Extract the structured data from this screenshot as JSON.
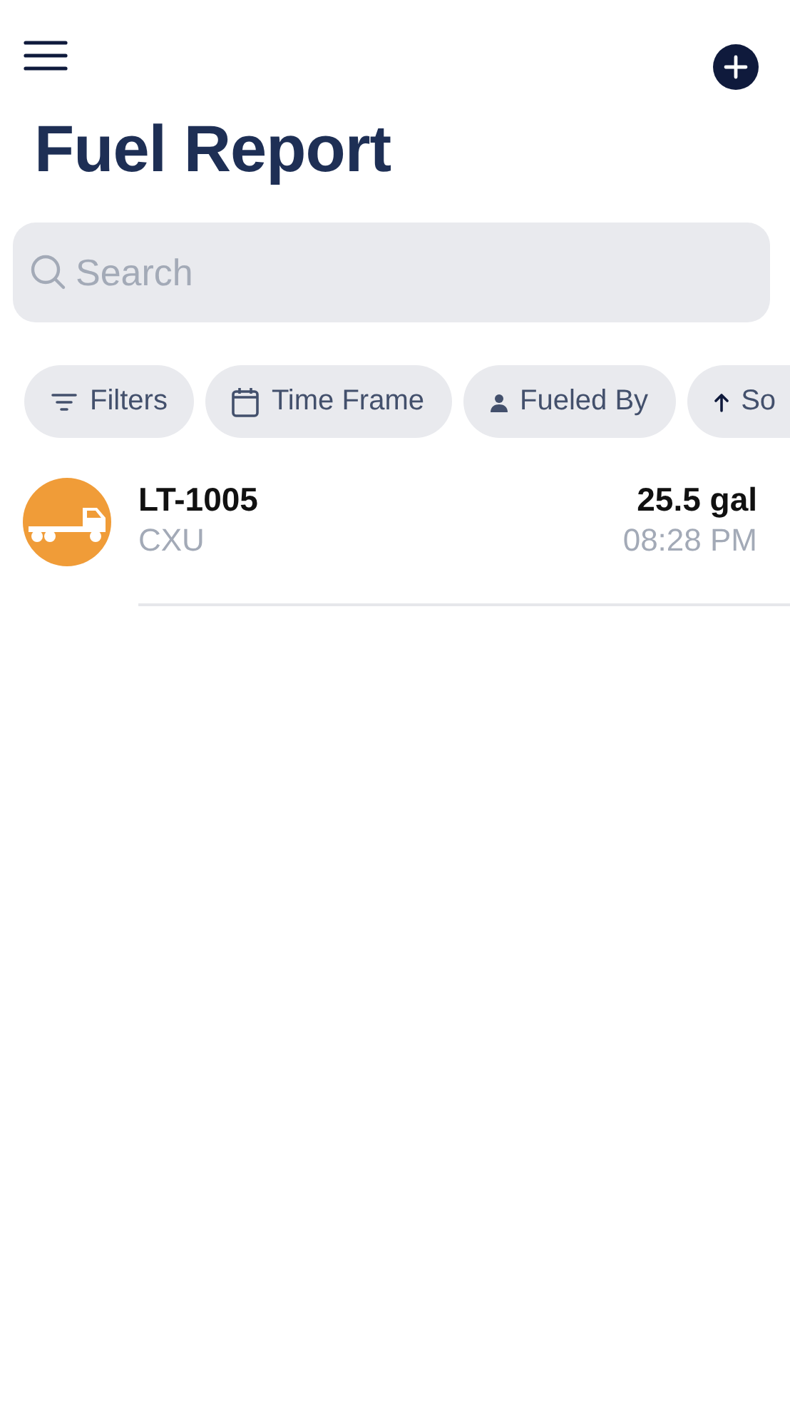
{
  "header": {
    "title": "Fuel Report"
  },
  "search": {
    "placeholder": "Search"
  },
  "chips": [
    {
      "kind": "filter",
      "label": "Filters"
    },
    {
      "kind": "calendar",
      "label": "Time Frame"
    },
    {
      "kind": "person",
      "label": "Fueled By"
    },
    {
      "kind": "sort",
      "label": "So"
    }
  ],
  "entries": [
    {
      "vehicle": "LT-1005",
      "code": "CXU",
      "amount": "25.5 gal",
      "time": "08:28 PM",
      "color": "#f09c38"
    }
  ]
}
